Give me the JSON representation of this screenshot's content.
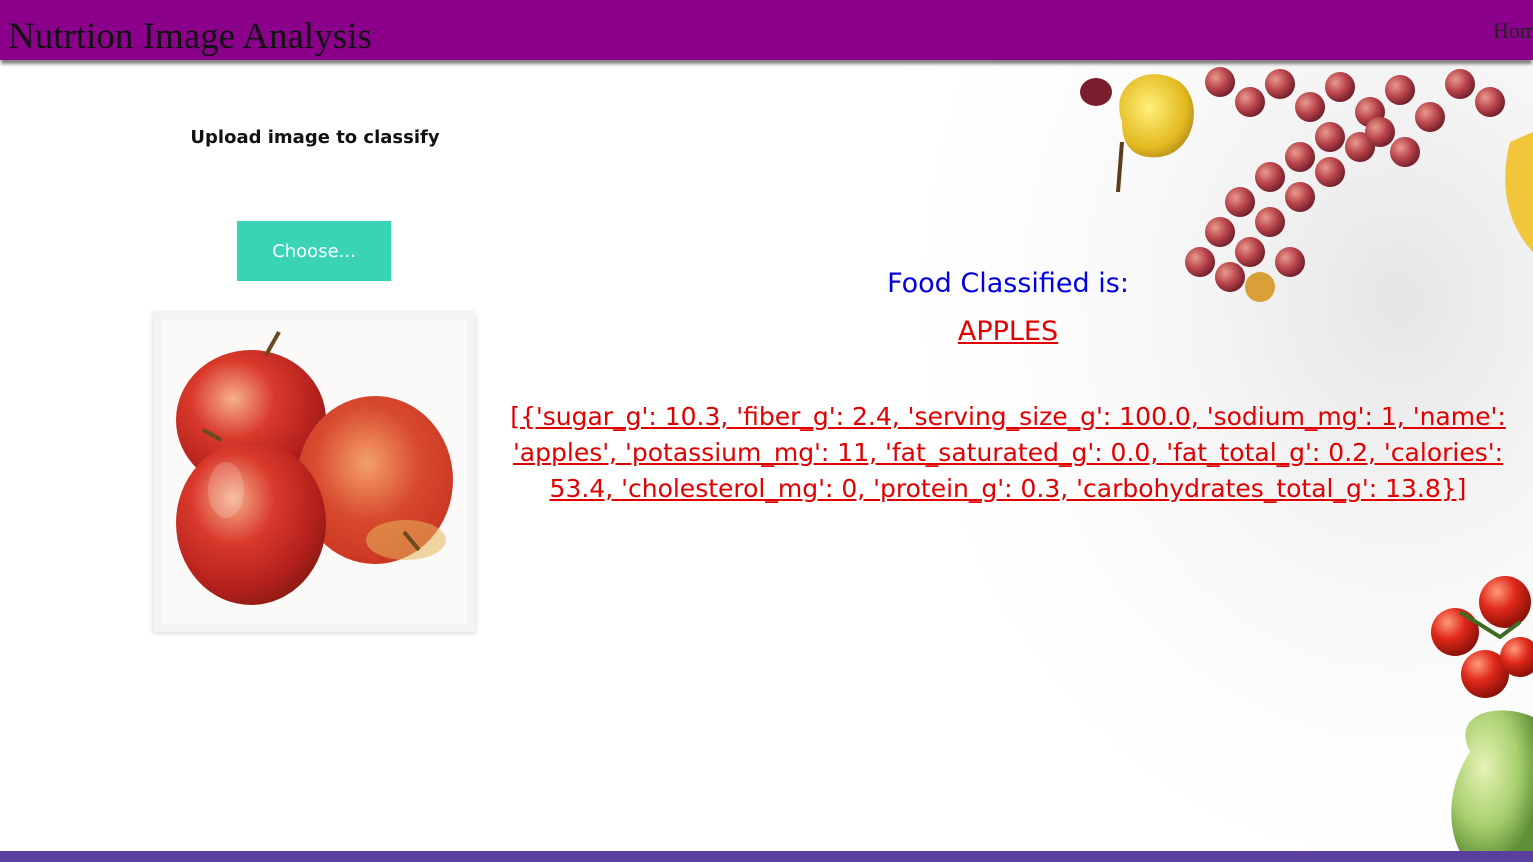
{
  "header": {
    "title": "Nutrtion Image Analysis",
    "nav_home": "Home",
    "background_color": "#8b008b"
  },
  "upload": {
    "label": "Upload image to classify",
    "button_label": "Choose...",
    "button_color": "#3ad3b6",
    "preview_alt": "three red apples"
  },
  "result": {
    "heading": "Food Classified is:",
    "food_name": "APPLES",
    "nutrition": "[{'sugar_g': 10.3, 'fiber_g': 2.4, 'serving_size_g': 100.0, 'sodium_mg': 1, 'name': 'apples', 'potassium_mg': 11, 'fat_saturated_g': 0.0, 'fat_total_g': 0.2, 'calories': 53.4, 'cholesterol_mg': 0, 'protein_g': 0.3, 'carbohydrates_total_g': 13.8}]",
    "heading_color": "#0000e0",
    "value_color": "#e00000"
  },
  "footer": {
    "bar_color": "#5b3f9e"
  }
}
